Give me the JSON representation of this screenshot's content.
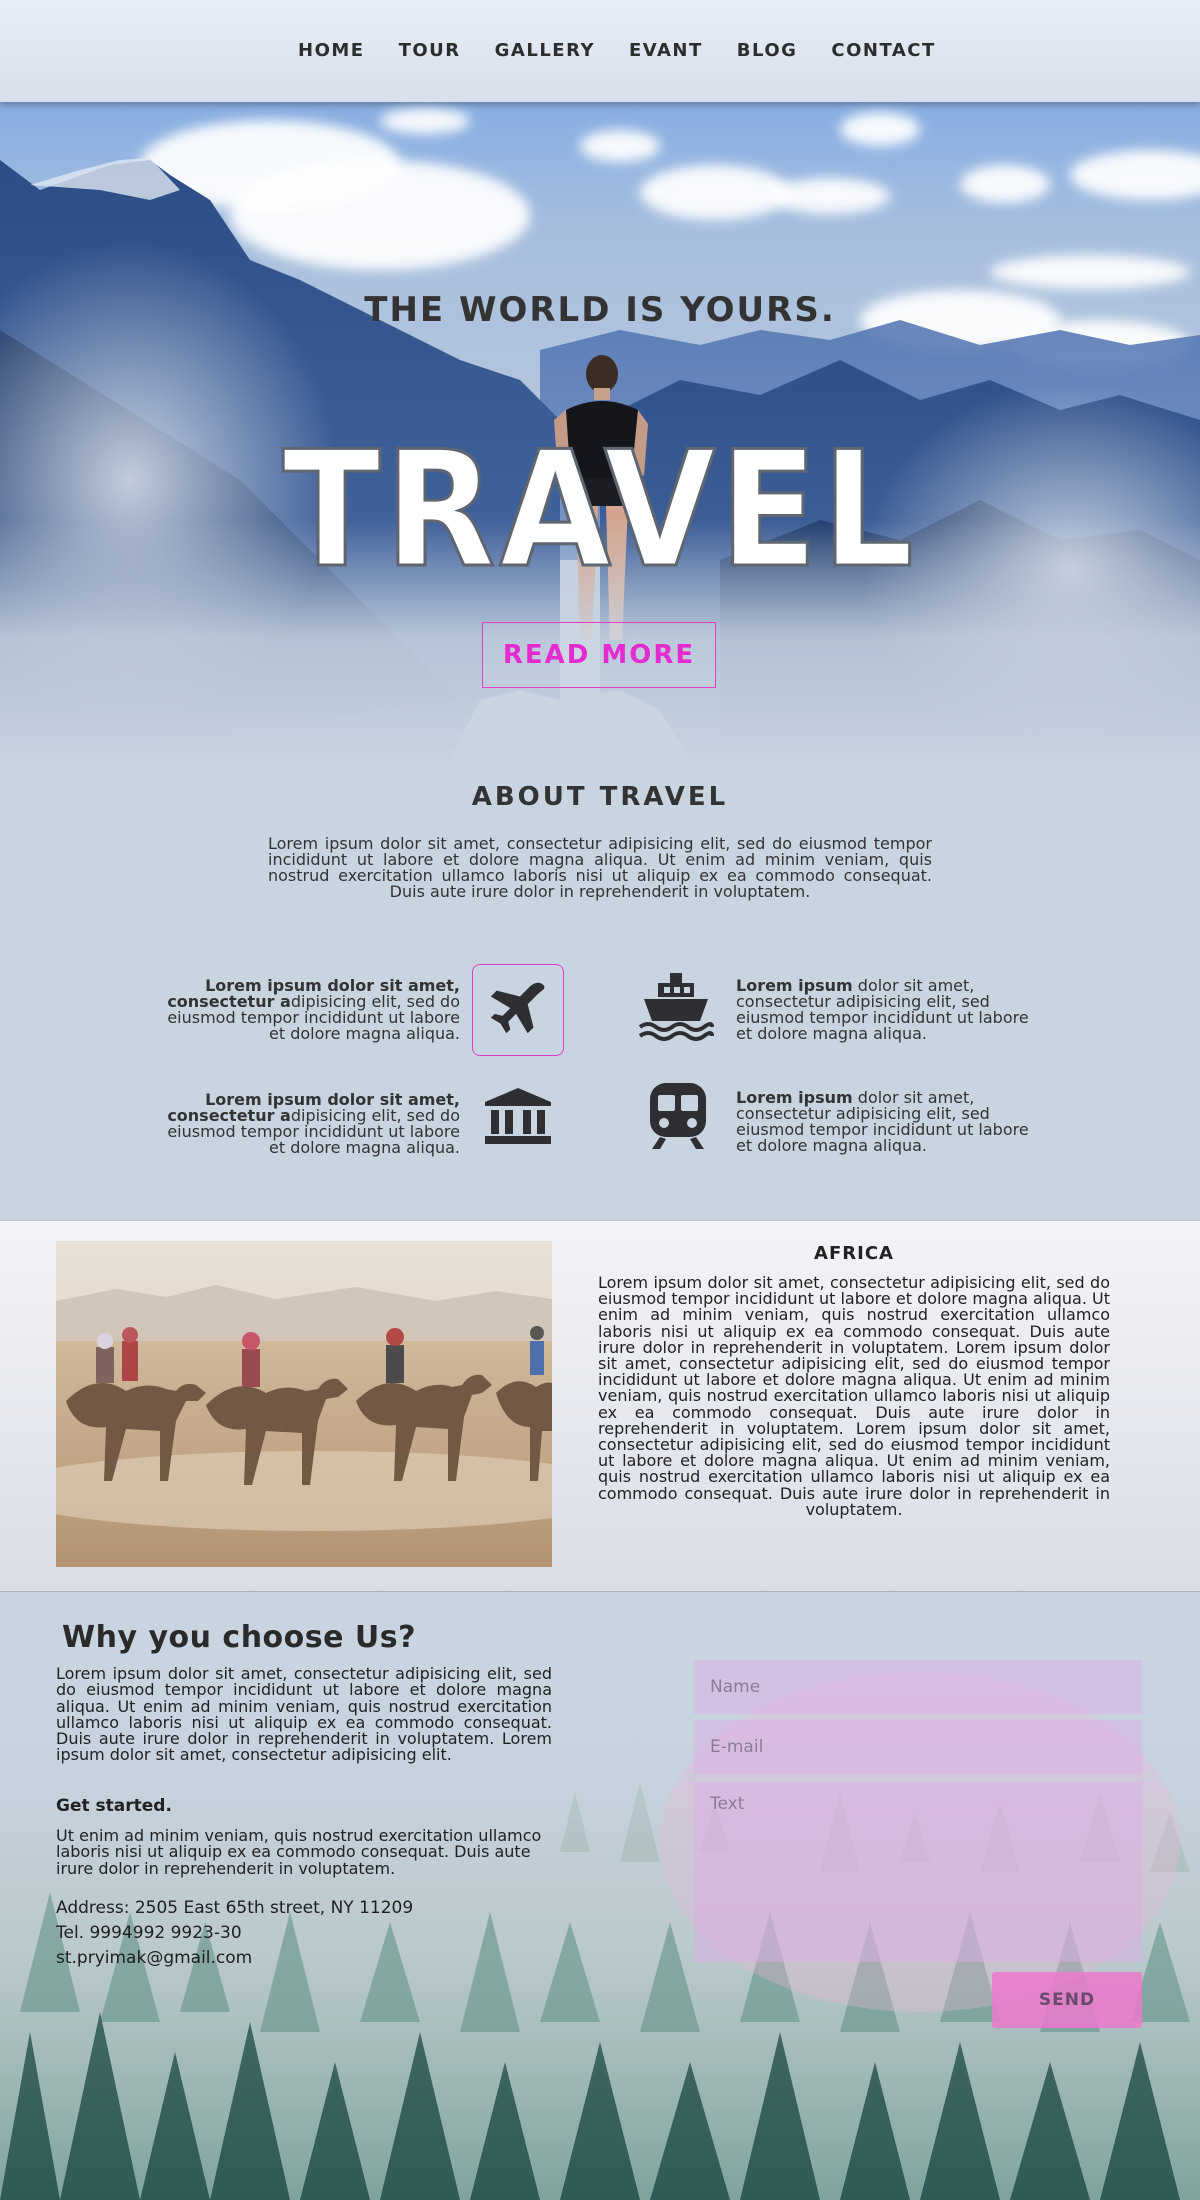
{
  "nav": {
    "items": [
      {
        "label": "HOME"
      },
      {
        "label": "TOUR"
      },
      {
        "label": "GALLERY"
      },
      {
        "label": "EVANT"
      },
      {
        "label": "BLOG"
      },
      {
        "label": "CONTACT"
      }
    ]
  },
  "hero": {
    "subtitle": "THE WORLD IS YOURS.",
    "title": "TRAVEL",
    "button": "READ MORE"
  },
  "about": {
    "title": "ABOUT TRAVEL",
    "text": "Lorem ipsum dolor sit amet, consectetur adipisicing elit, sed do eiusmod tempor incididunt ut labore et dolore magna aliqua. Ut enim ad minim veniam, quis nostrud exercitation ullamco laboris nisi ut aliquip ex ea commodo consequat. Duis aute irure dolor in reprehenderit in voluptatem."
  },
  "features": [
    {
      "bold": "Lorem ipsum dolor sit amet, consectetur a",
      "rest": "dipisicing elit, sed do eiusmod tempor incididunt ut labore et dolore magna aliqua.",
      "icon": "airplane-icon"
    },
    {
      "bold": "Lorem ipsum",
      "rest": " dolor sit amet, consectetur adipisicing elit, sed eiusmod tempor incididunt ut labore et dolore magna aliqua.",
      "icon": "ship-icon"
    },
    {
      "bold": "Lorem ipsum dolor sit amet, consectetur a",
      "rest": "dipisicing elit, sed do eiusmod tempor incididunt ut labore et dolore magna aliqua.",
      "icon": "museum-icon"
    },
    {
      "bold": "Lorem ipsum",
      "rest": " dolor sit amet, consectetur adipisicing elit, sed eiusmod tempor incididunt ut labore et dolore magna aliqua.",
      "icon": "train-icon"
    }
  ],
  "africa": {
    "title": "AFRICA",
    "text": "Lorem ipsum dolor sit amet, consectetur adipisicing elit, sed do eiusmod tempor incididunt ut labore et dolore magna aliqua. Ut enim ad minim veniam, quis nostrud exercitation ullamco laboris nisi ut aliquip ex ea commodo consequat. Duis aute irure dolor in reprehenderit in voluptatem. Lorem ipsum dolor sit amet, consectetur adipisicing elit, sed do eiusmod tempor incididunt ut labore et dolore magna aliqua. Ut enim ad minim veniam, quis nostrud exercitation ullamco laboris nisi ut aliquip ex ea commodo consequat. Duis aute irure dolor in reprehenderit in voluptatem. Lorem ipsum dolor sit amet, consectetur adipisicing elit, sed do eiusmod tempor incididunt ut labore et dolore magna aliqua. Ut enim ad minim veniam, quis nostrud exercitation ullamco laboris nisi ut aliquip ex ea commodo consequat. Duis aute irure dolor in reprehenderit in voluptatem."
  },
  "why": {
    "title": "Why you choose Us?",
    "text": "Lorem ipsum dolor sit amet, consectetur adipisicing elit, sed do eiusmod tempor incididunt ut labore et dolore magna aliqua. Ut enim ad minim veniam, quis nostrud exercitation ullamco laboris nisi ut aliquip ex ea commodo consequat. Duis aute irure dolor in reprehenderit in voluptatem. Lorem ipsum dolor sit amet, consectetur adipisicing elit.",
    "get_started": "Get started.",
    "text2": "Ut enim ad minim veniam, quis nostrud exercitation ullamco laboris nisi ut aliquip ex ea commodo consequat. Duis aute irure dolor in reprehenderit in voluptatem.",
    "address": "Address: 2505 East 65th street, NY 11209",
    "tel": "Tel. 9994992 9923-30",
    "email": "st.pryimak@gmail.com"
  },
  "form": {
    "name_placeholder": "Name",
    "email_placeholder": "E-mail",
    "text_placeholder": "Text",
    "send": "SEND"
  },
  "colors": {
    "accent": "#e52ad0",
    "text": "#2e2e2e",
    "background": "#c9d4e1"
  }
}
